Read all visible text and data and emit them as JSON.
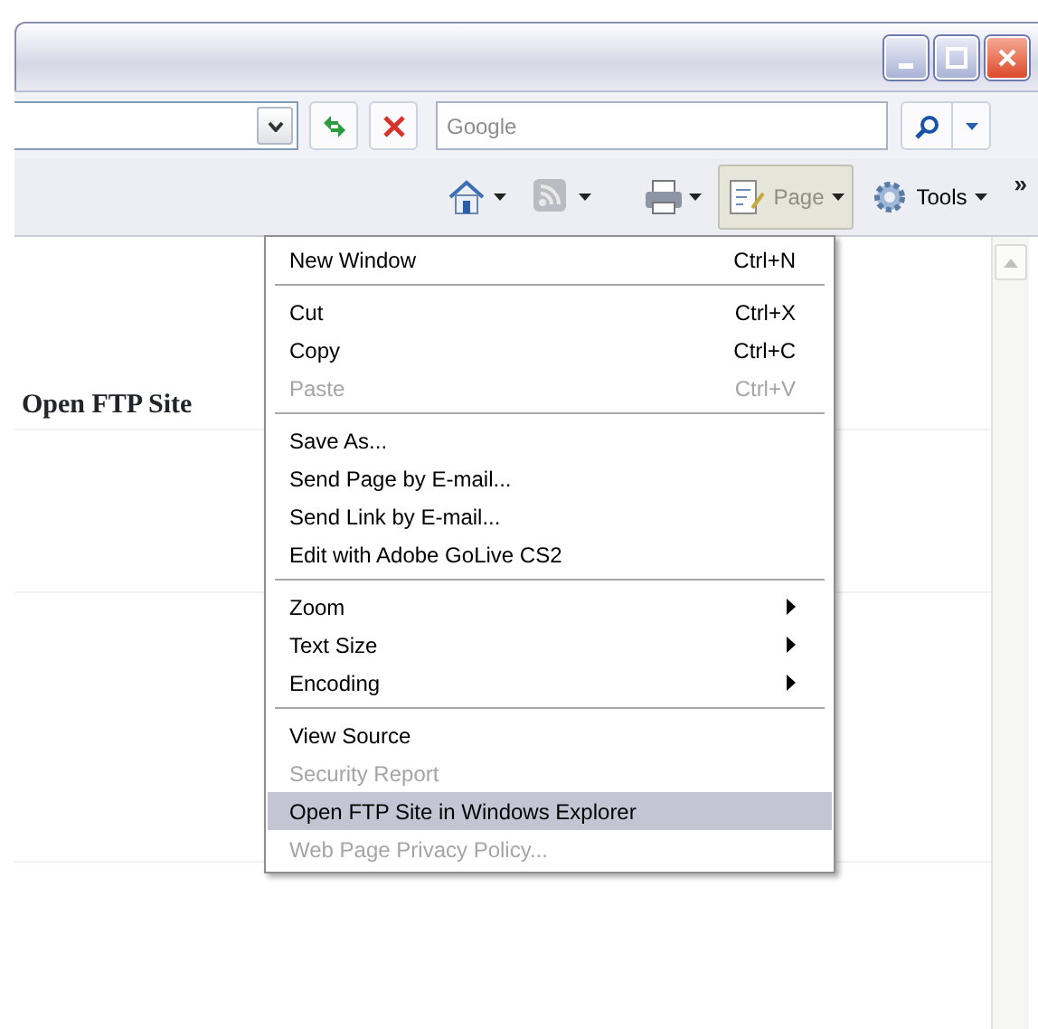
{
  "address_bar": {
    "search_placeholder": "Google"
  },
  "command_bar": {
    "buttons": [
      {
        "kind": "home",
        "dropdown": true
      },
      {
        "kind": "feed",
        "dropdown": true
      },
      {
        "kind": "print",
        "dropdown": true
      },
      {
        "kind": "page",
        "label": "Page",
        "dropdown": true,
        "selected": true
      },
      {
        "kind": "tools",
        "label": "Tools",
        "dropdown": true,
        "selected": false
      }
    ],
    "overflow": "»"
  },
  "page": {
    "heading": "Open FTP Site"
  },
  "menu": {
    "items": [
      {
        "kind": "item",
        "label": "New Window",
        "shortcut": "Ctrl+N",
        "disabled": false,
        "submenu": false,
        "selected": false
      },
      {
        "kind": "separator"
      },
      {
        "kind": "item",
        "label": "Cut",
        "shortcut": "Ctrl+X",
        "disabled": false,
        "submenu": false,
        "selected": false
      },
      {
        "kind": "item",
        "label": "Copy",
        "shortcut": "Ctrl+C",
        "disabled": false,
        "submenu": false,
        "selected": false
      },
      {
        "kind": "item",
        "label": "Paste",
        "shortcut": "Ctrl+V",
        "disabled": true,
        "submenu": false,
        "selected": false
      },
      {
        "kind": "separator"
      },
      {
        "kind": "item",
        "label": "Save As...",
        "disabled": false,
        "submenu": false,
        "selected": false
      },
      {
        "kind": "item",
        "label": "Send Page by E-mail...",
        "disabled": false,
        "submenu": false,
        "selected": false
      },
      {
        "kind": "item",
        "label": "Send Link by E-mail...",
        "disabled": false,
        "submenu": false,
        "selected": false
      },
      {
        "kind": "item",
        "label": "Edit with Adobe GoLive CS2",
        "disabled": false,
        "submenu": false,
        "selected": false
      },
      {
        "kind": "separator"
      },
      {
        "kind": "item",
        "label": "Zoom",
        "disabled": false,
        "submenu": true,
        "selected": false
      },
      {
        "kind": "item",
        "label": "Text Size",
        "disabled": false,
        "submenu": true,
        "selected": false
      },
      {
        "kind": "item",
        "label": "Encoding",
        "disabled": false,
        "submenu": true,
        "selected": false
      },
      {
        "kind": "separator"
      },
      {
        "kind": "item",
        "label": "View Source",
        "disabled": false,
        "submenu": false,
        "selected": false
      },
      {
        "kind": "item",
        "label": "Security Report",
        "disabled": true,
        "submenu": false,
        "selected": false
      },
      {
        "kind": "item",
        "label": "Open FTP Site in Windows Explorer",
        "disabled": false,
        "submenu": false,
        "selected": true
      },
      {
        "kind": "item",
        "label": "Web Page Privacy Policy...",
        "disabled": true,
        "submenu": false,
        "selected": false
      }
    ]
  }
}
